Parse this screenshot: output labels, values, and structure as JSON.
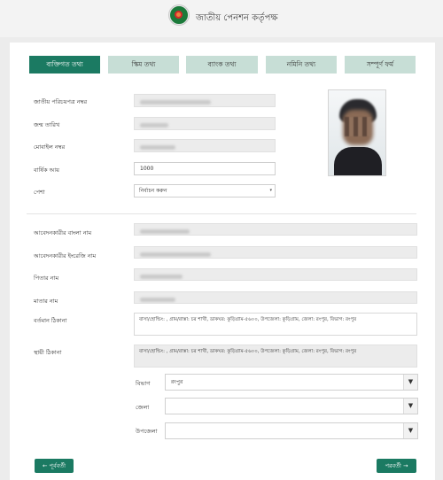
{
  "header": {
    "title": "জাতীয় পেনশন কর্তৃপক্ষ"
  },
  "tabs": [
    {
      "label": "ব্যক্তিগত তথ্য",
      "active": true
    },
    {
      "label": "স্কিম তথ্য",
      "active": false
    },
    {
      "label": "ব্যাংক তথ্য",
      "active": false
    },
    {
      "label": "নমিনি তথ্য",
      "active": false
    },
    {
      "label": "সম্পূর্ণ ফর্ম",
      "active": false
    }
  ],
  "personal": {
    "nid_label": "জাতীয় পরিচয়পত্র নম্বর",
    "dob_label": "জন্ম তারিখ",
    "mobile_label": "মোবাইল নম্বর",
    "income_label": "বার্ষিক আয়",
    "income_value": "1000",
    "profession_label": "পেশা",
    "profession_selected": "নির্বাচন করুন"
  },
  "names": {
    "bangla_name_label": "আবেদনকারীর বাংলা নাম",
    "english_name_label": "আবেদনকারীর ইংরেজি নাম",
    "father_label": "পিতার নাম",
    "mother_label": "মাতার নাম"
  },
  "address": {
    "present_label": "বর্তমান ঠিকানা",
    "present_value": "বাসা/হোল্ডিং: , গ্রাম/রাস্তা: চর শাখী, ডাকঘর: কুড়িগ্রাম-৫৬০০, উপজেলা: কুড়িগ্রাম, জেলা: রংপুর, বিভাগ: রংপুর",
    "permanent_label": "স্থায়ী ঠিকানা",
    "permanent_value": "বাসা/হোল্ডিং: , গ্রাম/রাস্তা: চর শাখী, ডাকঘর: কুড়িগ্রাম-৫৬০০, উপজেলা: কুড়িগ্রাম, জেলা: রংপুর, বিভাগ: রংপুর",
    "division_label": "বিভাগ",
    "division_value": "রংপুর",
    "district_label": "জেলা",
    "district_value": "",
    "upazila_label": "উপজেলা",
    "upazila_value": ""
  },
  "footer": {
    "prev_label": "← পূর্ববর্তী",
    "next_label": "পরবর্তী →"
  },
  "icons": {
    "logo": "government-seal-icon",
    "caret": "chevron-down-icon"
  },
  "colors": {
    "accent": "#1b7a62",
    "tab_inactive": "#c7ded6"
  }
}
